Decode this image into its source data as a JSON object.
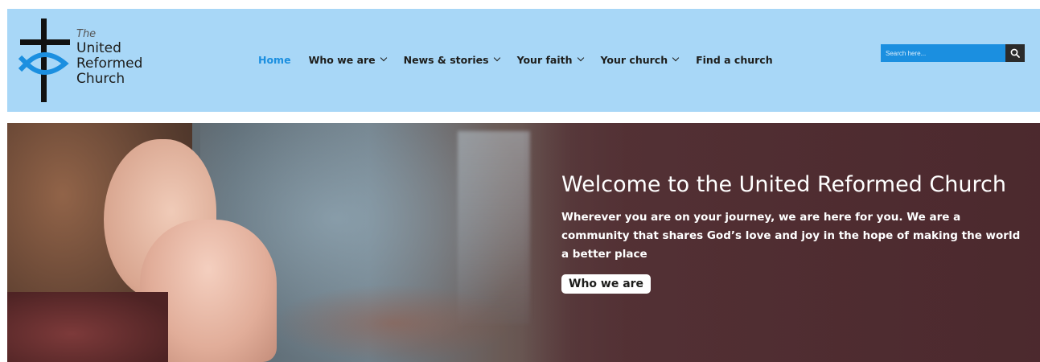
{
  "colors": {
    "header_bg": "#a8d7f7",
    "accent": "#1b8fe0",
    "text_dark": "#1d1d1b",
    "hero_overlay": "#4f2d31"
  },
  "logo": {
    "line1": "The",
    "line2": "United",
    "line3": "Reformed",
    "line4": "Church",
    "icon": "cross-fish-icon"
  },
  "nav": {
    "items": [
      {
        "label": "Home",
        "active": true,
        "dropdown": false
      },
      {
        "label": "Who we are",
        "active": false,
        "dropdown": true
      },
      {
        "label": "News & stories",
        "active": false,
        "dropdown": true
      },
      {
        "label": "Your faith",
        "active": false,
        "dropdown": true
      },
      {
        "label": "Your church",
        "active": false,
        "dropdown": true
      },
      {
        "label": "Find a church",
        "active": false,
        "dropdown": false
      }
    ]
  },
  "search": {
    "placeholder": "Search here...",
    "value": "",
    "icon": "search-icon"
  },
  "hero": {
    "title": "Welcome to the United Reformed Church",
    "text": "Wherever you are on your journey, we are here for you. We are a community that shares God’s love and joy in the hope of making the world a better place",
    "button_label": "Who we are"
  }
}
